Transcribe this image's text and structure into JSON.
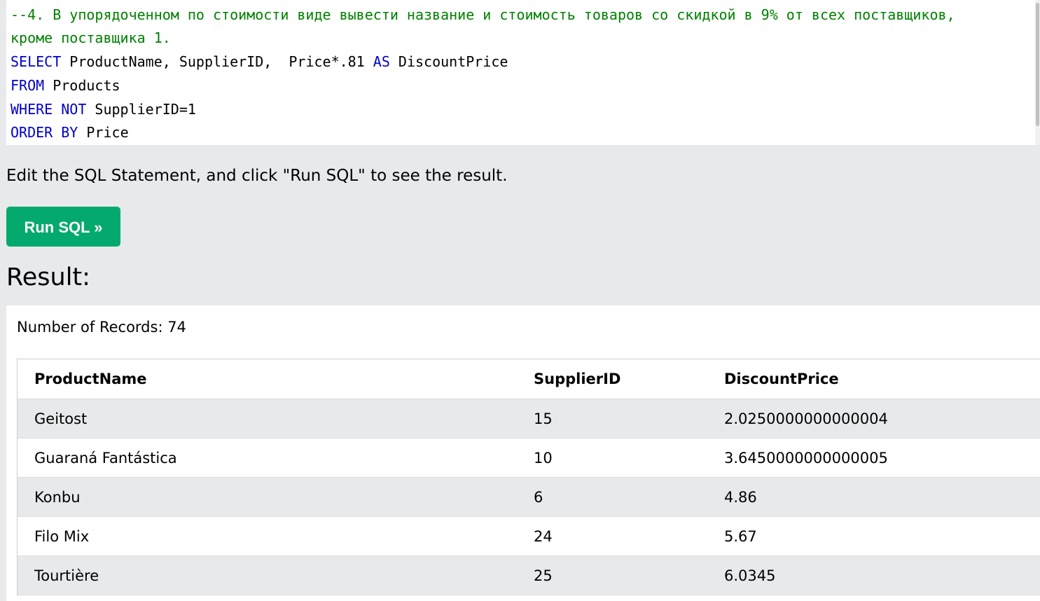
{
  "editor": {
    "comment_line1": "--4. В упорядоченном по стоимости виде вывести название и стоимость товаров со скидкой в 9% от всех поставщиков,",
    "comment_line2": "кроме поставщика 1.",
    "line3": {
      "kw1": "SELECT",
      "text1": " ProductName, SupplierID,  Price*.81 ",
      "kw2": "AS",
      "text2": " DiscountPrice"
    },
    "line4": {
      "kw1": "FROM",
      "text1": " Products"
    },
    "line5": {
      "kw1": "WHERE",
      "sp": " ",
      "kw2": "NOT",
      "text1": " SupplierID=1"
    },
    "line6": {
      "kw1": "ORDER",
      "sp": " ",
      "kw2": "BY",
      "text1": " Price"
    }
  },
  "instruction": "Edit the SQL Statement, and click \"Run SQL\" to see the result.",
  "run_button_label": "Run SQL »",
  "result_heading": "Result:",
  "records_text": "Number of Records: 74",
  "table": {
    "headers": [
      "ProductName",
      "SupplierID",
      "DiscountPrice"
    ],
    "rows": [
      [
        "Geitost",
        "15",
        "2.0250000000000004"
      ],
      [
        "Guaraná Fantástica",
        "10",
        "3.6450000000000005"
      ],
      [
        "Konbu",
        "6",
        "4.86"
      ],
      [
        "Filo Mix",
        "24",
        "5.67"
      ],
      [
        "Tourtière",
        "25",
        "6.0345"
      ]
    ]
  },
  "colors": {
    "background": "#e7e9eb",
    "button": "#04aa6d",
    "comment": "#008000",
    "keyword": "#0000cd"
  }
}
